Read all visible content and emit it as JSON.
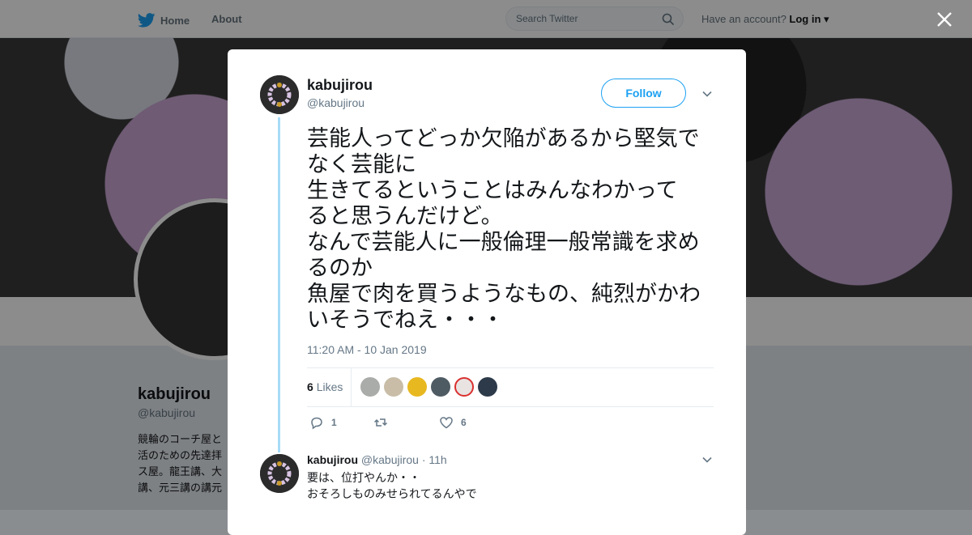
{
  "nav": {
    "home_label": "Home",
    "about_label": "About",
    "search_placeholder": "Search Twitter",
    "have_account": "Have an account?",
    "login_label": "Log in"
  },
  "profile": {
    "name": "kabujirou",
    "handle": "@kabujirou",
    "bio_lines": [
      "競輪のコーチ屋と",
      "活のための先達拝",
      "ス屋。龍王講、大",
      "講、元三講の講元"
    ]
  },
  "tweet": {
    "author_name": "kabujirou",
    "author_handle": "@kabujirou",
    "follow_label": "Follow",
    "text_lines": [
      "芸能人ってどっか欠陥があるから堅気で",
      "なく芸能に",
      "生きてるということはみんなわかって",
      "ると思うんだけど。",
      "なんで芸能人に一般倫理一般常識を求め",
      "るのか",
      "魚屋で肉を買うようなもの、純烈がかわ",
      "いそうでねえ・・・"
    ],
    "timestamp": "11:20 AM - 10 Jan 2019",
    "likes_count": "6",
    "likes_label": "Likes",
    "reply_count": "1",
    "retweet_count": "",
    "like_count": "6"
  },
  "reply": {
    "author_name": "kabujirou",
    "author_handle": "@kabujirou",
    "time": "· 11h",
    "text_lines": [
      "要は、位打やんか・・",
      "おそろしものみせられてるんやで"
    ]
  },
  "colors": {
    "accent": "#1da1f2",
    "thread_line": "#a8dcf8",
    "text_secondary": "#657786"
  }
}
